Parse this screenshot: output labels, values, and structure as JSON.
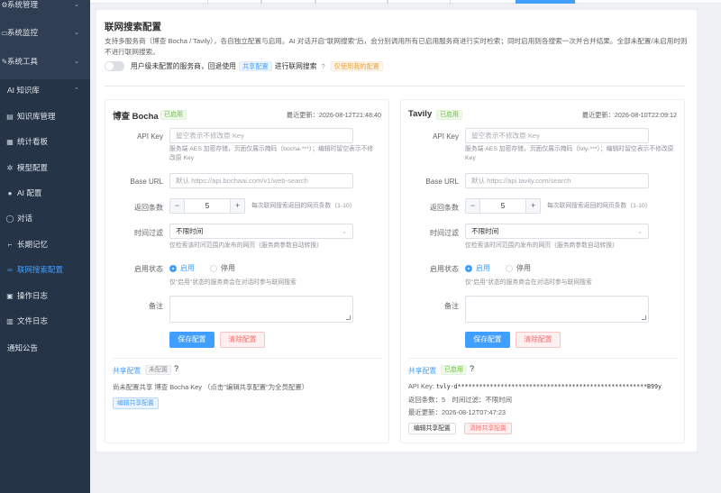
{
  "sidebar": {
    "items": [
      {
        "label": "系统管理",
        "icon": "gear-icon",
        "arrow": "⌄"
      },
      {
        "label": "系统监控",
        "icon": "monitor-icon",
        "arrow": "⌄"
      },
      {
        "label": "系统工具",
        "icon": "tool-icon",
        "arrow": "⌄"
      },
      {
        "label": "AI 知识库",
        "icon": "ai-icon",
        "arrow": "⌃"
      },
      {
        "label": "知识库管理",
        "icon": "book-icon"
      },
      {
        "label": "统计看板",
        "icon": "chart-icon"
      },
      {
        "label": "模型配置",
        "icon": "cube-icon"
      },
      {
        "label": "AI 配置",
        "icon": "user-icon"
      },
      {
        "label": "对话",
        "icon": "chat-icon"
      },
      {
        "label": "长期记忆",
        "icon": "memory-icon"
      },
      {
        "label": "联网搜索配置",
        "icon": "link-icon"
      },
      {
        "label": "操作日志",
        "icon": "log-icon"
      },
      {
        "label": "文件日志",
        "icon": "file-icon"
      },
      {
        "label": "通知公告",
        "icon": "bell-icon"
      }
    ],
    "active_index": 10
  },
  "page": {
    "title": "联网搜索配置",
    "description": "支持多服务商（博查 Bocha / Tavily），各自独立配置与启用。AI 对话开启\"联网搜索\"后，会分别调用所有已启用服务商进行实时检索；同时启用则各搜索一次并合并结果。全部未配置/未启用时则不进行联网搜索。",
    "toggle_text_before": "用户级未配置的服务商，回退使用",
    "toggle_tag": "共享配置",
    "toggle_text_after": "进行联网搜索",
    "toggle_q": "?",
    "toggle_tag2": "仅使用我的配置"
  },
  "labels": {
    "api_key": "API Key",
    "base_url": "Base URL",
    "count": "返回条数",
    "time_filter": "时间过滤",
    "status": "启用状态",
    "remark": "备注",
    "enabled": "启用",
    "disabled": "停用",
    "save": "保存配置",
    "clear": "清除配置",
    "status_hint": "仅\"启用\"状态的服务商会在对话时参与联网搜索",
    "time_hint": "仅检索该时间范围内发布的网页（服务商参数自动转换）",
    "count_hint": "每次联网搜索返回的网页条数（1-10）",
    "api_key_placeholder": "留空表示不修改原 Key",
    "share_label": "共享配置",
    "share_q": "?",
    "minus": "−",
    "plus": "+",
    "select_arrow": "⌄"
  },
  "bocha": {
    "name": "博查 Bocha",
    "status_tag": "已启用",
    "updated": "最近更新：2026-08-12T21:48:40",
    "api_key_hint": "服务端 AES 加密存储，页面仅展示掩码（bocha-***）；编辑时留空表示不修改原 Key",
    "base_url_placeholder": "默认 https://api.bochaai.com/v1/web-search",
    "count": "5",
    "time_filter": "不限时间",
    "share_tag": "未配置",
    "share_text": "尚未配置共享 博查 Bocha Key （点击\"编辑共享配置\"为全员配置）",
    "share_button": "编辑共享配置"
  },
  "tavily": {
    "name": "Tavily",
    "status_tag": "已启用",
    "updated": "最近更新：2026-08-10T22:09:12",
    "api_key_hint": "服务端 AES 加密存储，页面仅展示掩码（tvly-***）；编辑时留空表示不修改原 Key",
    "base_url_placeholder": "默认 https://api.tavily.com/search",
    "count": "5",
    "time_filter": "不限时间",
    "share_tag": "已启用",
    "share_api_key_label": "API Key:",
    "share_api_key_value": "tvly-d*****************************************************B99y",
    "share_meta": "返回条数：5　时间过滤：不限时间",
    "share_updated": "最近更新：2026-08-12T07:47:23",
    "share_edit_button": "编辑共享配置",
    "share_clear_button": "清除共享配置"
  }
}
